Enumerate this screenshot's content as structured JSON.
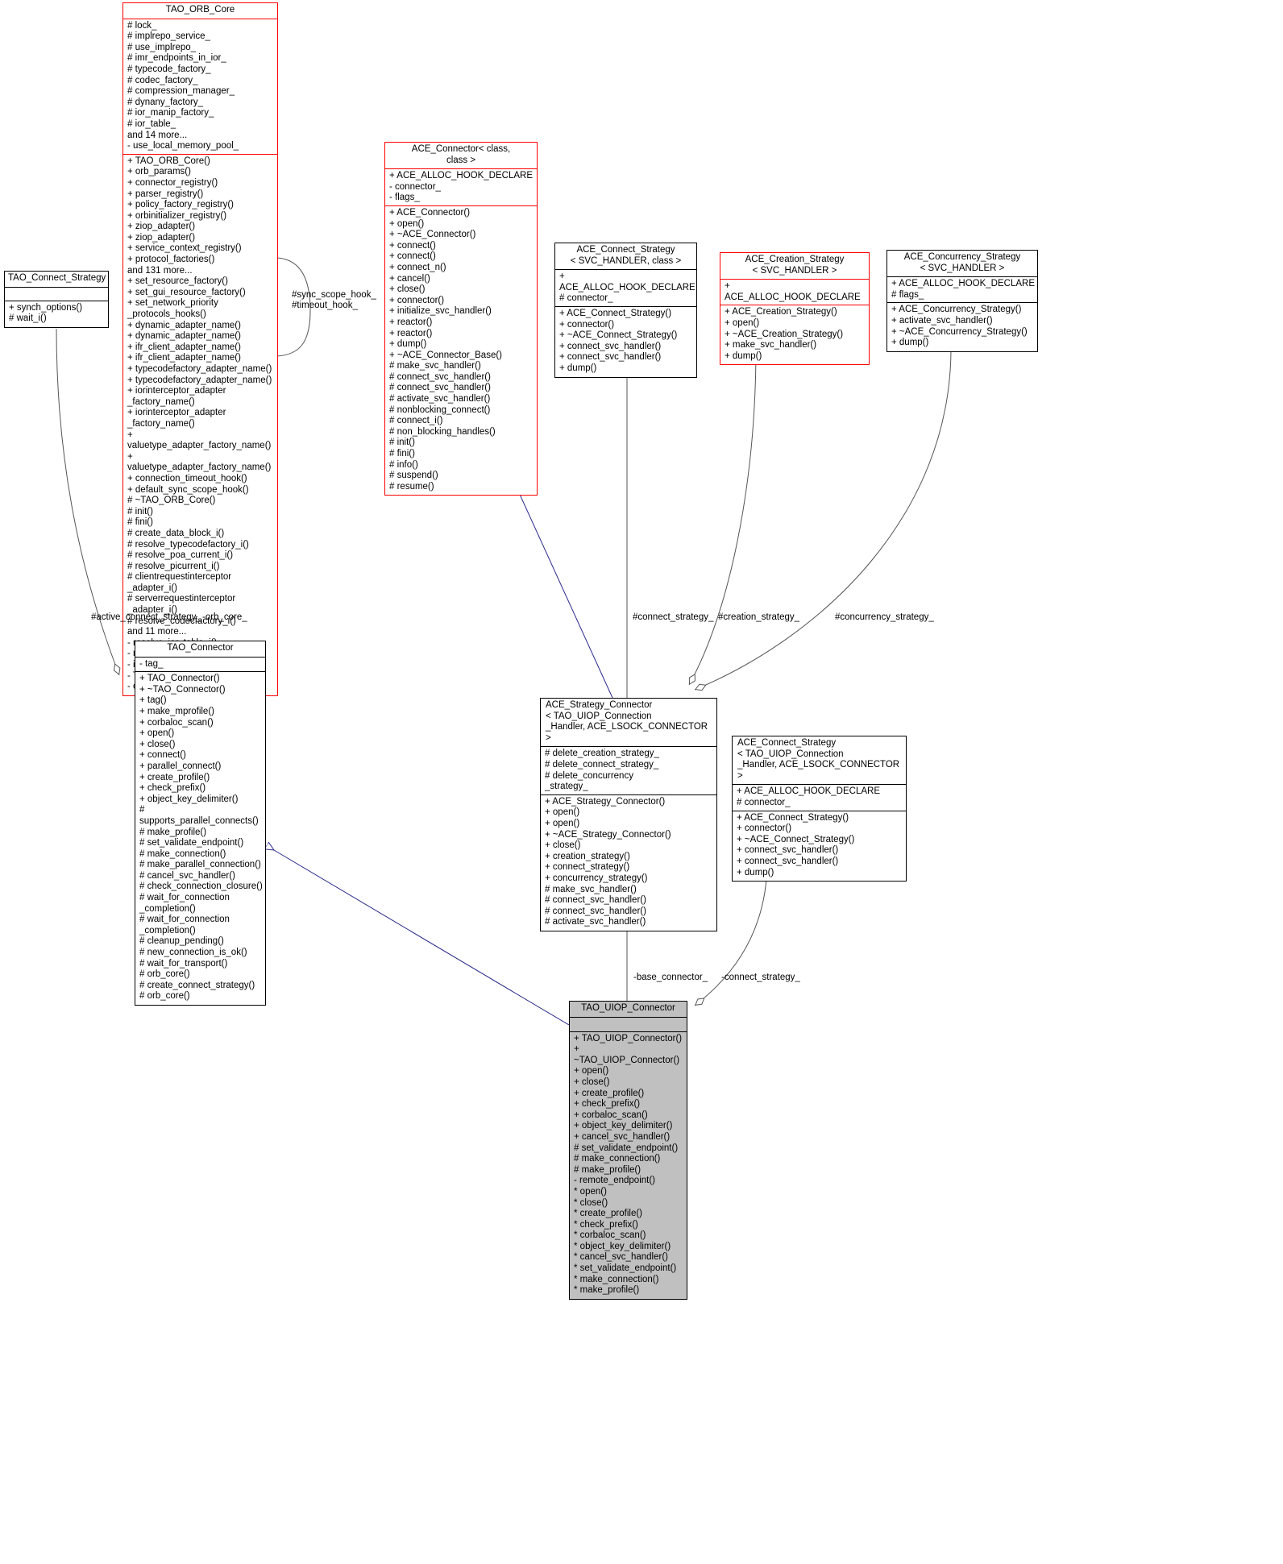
{
  "diagram": {
    "type": "uml-class-diagram",
    "colors": {
      "red_border": "#ff0000",
      "black_border": "#000000",
      "selected_fill": "#c0c0c0",
      "inheritance_arrow": "#2a2a8c",
      "background": "#ffffff"
    }
  },
  "classes": {
    "tao_orb_core": {
      "name": "TAO_ORB_Core",
      "attrs": [
        "# lock_",
        "# implrepo_service_",
        "# use_implrepo_",
        "# imr_endpoints_in_ior_",
        "# typecode_factory_",
        "# codec_factory_",
        "# compression_manager_",
        "# dynany_factory_",
        "# ior_manip_factory_",
        "# ior_table_",
        "and 14 more...",
        "- use_local_memory_pool_"
      ],
      "ops": [
        "+ TAO_ORB_Core()",
        "+ orb_params()",
        "+ connector_registry()",
        "+ parser_registry()",
        "+ policy_factory_registry()",
        "+ orbinitializer_registry()",
        "+ ziop_adapter()",
        "+ ziop_adapter()",
        "+ service_context_registry()",
        "+ protocol_factories()",
        "and 131 more...",
        "+ set_resource_factory()",
        "+ set_gui_resource_factory()",
        "+ set_network_priority\n_protocols_hooks()",
        "+ dynamic_adapter_name()",
        "+ dynamic_adapter_name()",
        "+ ifr_client_adapter_name()",
        "+ ifr_client_adapter_name()",
        "+ typecodefactory_adapter_name()",
        "+ typecodefactory_adapter_name()",
        "+ iorinterceptor_adapter\n_factory_name()",
        "+ iorinterceptor_adapter\n_factory_name()",
        "+ valuetype_adapter_factory_name()",
        "+ valuetype_adapter_factory_name()",
        "+ connection_timeout_hook()",
        "+ default_sync_scope_hook()",
        "# ~TAO_ORB_Core()",
        "# init()",
        "# fini()",
        "# create_data_block_i()",
        "# resolve_typecodefactory_i()",
        "# resolve_poa_current_i()",
        "# resolve_picurrent_i()",
        "# clientrequestinterceptor\n_adapter_i()",
        "# serverrequestinterceptor\n_adapter_i()",
        "# resolve_codecfactory_i()",
        "and 11 more...",
        "- resolve_ior_table_i()",
        "- resolve_async_ior_table_i()",
        "- is_collocation_enabled()",
        "- TAO_ORB_Core()",
        "- operator=()"
      ]
    },
    "tao_connect_strategy": {
      "name": "TAO_Connect_Strategy",
      "attrs": [],
      "ops": [
        "+ synch_options()",
        "# wait_i()"
      ]
    },
    "ace_connector": {
      "name": "ACE_Connector< class,\n            class >",
      "attrs": [
        "+ ACE_ALLOC_HOOK_DECLARE",
        "- connector_",
        "- flags_"
      ],
      "ops": [
        "+ ACE_Connector()",
        "+ open()",
        "+ ~ACE_Connector()",
        "+ connect()",
        "+ connect()",
        "+ connect_n()",
        "+ cancel()",
        "+ close()",
        "+ connector()",
        "+ initialize_svc_handler()",
        "+ reactor()",
        "+ reactor()",
        "+ dump()",
        "+ ~ACE_Connector_Base()",
        "# make_svc_handler()",
        "# connect_svc_handler()",
        "# connect_svc_handler()",
        "# activate_svc_handler()",
        "# nonblocking_connect()",
        "# connect_i()",
        "# non_blocking_handles()",
        "# init()",
        "# fini()",
        "# info()",
        "# suspend()",
        "# resume()"
      ]
    },
    "ace_connect_strategy_generic": {
      "name": "ACE_Connect_Strategy\n< SVC_HANDLER, class >",
      "attrs": [
        "+ ACE_ALLOC_HOOK_DECLARE",
        "# connector_"
      ],
      "ops": [
        "+ ACE_Connect_Strategy()",
        "+ connector()",
        "+ ~ACE_Connect_Strategy()",
        "+ connect_svc_handler()",
        "+ connect_svc_handler()",
        "+ dump()"
      ]
    },
    "ace_creation_strategy": {
      "name": "ACE_Creation_Strategy\n< SVC_HANDLER >",
      "attrs": [
        "+ ACE_ALLOC_HOOK_DECLARE"
      ],
      "ops": [
        "+ ACE_Creation_Strategy()",
        "+ open()",
        "+ ~ACE_Creation_Strategy()",
        "+ make_svc_handler()",
        "+ dump()"
      ]
    },
    "ace_concurrency_strategy": {
      "name": "ACE_Concurrency_Strategy\n< SVC_HANDLER >",
      "attrs": [
        "+ ACE_ALLOC_HOOK_DECLARE",
        "# flags_"
      ],
      "ops": [
        "+ ACE_Concurrency_Strategy()",
        "+ activate_svc_handler()",
        "+ ~ACE_Concurrency_Strategy()",
        "+ dump()"
      ]
    },
    "tao_connector": {
      "name": "TAO_Connector",
      "attrs": [
        "- tag_"
      ],
      "ops": [
        "+ TAO_Connector()",
        "+ ~TAO_Connector()",
        "+ tag()",
        "+ make_mprofile()",
        "+ corbaloc_scan()",
        "+ open()",
        "+ close()",
        "+ connect()",
        "+ parallel_connect()",
        "+ create_profile()",
        "+ check_prefix()",
        "+ object_key_delimiter()",
        "# supports_parallel_connects()",
        "# make_profile()",
        "# set_validate_endpoint()",
        "# make_connection()",
        "# make_parallel_connection()",
        "# cancel_svc_handler()",
        "# check_connection_closure()",
        "# wait_for_connection\n_completion()",
        "# wait_for_connection\n_completion()",
        "# cleanup_pending()",
        "# new_connection_is_ok()",
        "# wait_for_transport()",
        "# orb_core()",
        "# create_connect_strategy()",
        "# orb_core()"
      ]
    },
    "ace_strategy_connector": {
      "name": "ACE_Strategy_Connector\n< TAO_UIOP_Connection\n_Handler, ACE_LSOCK_CONNECTOR >",
      "attrs": [
        "# delete_creation_strategy_",
        "# delete_connect_strategy_",
        "# delete_concurrency\n_strategy_"
      ],
      "ops": [
        "+ ACE_Strategy_Connector()",
        "+ open()",
        "+ open()",
        "+ ~ACE_Strategy_Connector()",
        "+ close()",
        "+ creation_strategy()",
        "+ connect_strategy()",
        "+ concurrency_strategy()",
        "# make_svc_handler()",
        "# connect_svc_handler()",
        "# connect_svc_handler()",
        "# activate_svc_handler()"
      ]
    },
    "ace_connect_strategy_uiop": {
      "name": "ACE_Connect_Strategy\n< TAO_UIOP_Connection\n_Handler, ACE_LSOCK_CONNECTOR >",
      "attrs": [
        "+ ACE_ALLOC_HOOK_DECLARE",
        "# connector_"
      ],
      "ops": [
        "+ ACE_Connect_Strategy()",
        "+ connector()",
        "+ ~ACE_Connect_Strategy()",
        "+ connect_svc_handler()",
        "+ connect_svc_handler()",
        "+ dump()"
      ]
    },
    "tao_uiop_connector": {
      "name": "TAO_UIOP_Connector",
      "attrs": [],
      "ops": [
        "+ TAO_UIOP_Connector()",
        "+ ~TAO_UIOP_Connector()",
        "+ open()",
        "+ close()",
        "+ create_profile()",
        "+ check_prefix()",
        "+ corbaloc_scan()",
        "+ object_key_delimiter()",
        "+ cancel_svc_handler()",
        "# set_validate_endpoint()",
        "# make_connection()",
        "# make_profile()",
        "- remote_endpoint()",
        "* open()",
        "* close()",
        "* create_profile()",
        "* check_prefix()",
        "* corbaloc_scan()",
        "* object_key_delimiter()",
        "* cancel_svc_handler()",
        "* set_validate_endpoint()",
        "* make_connection()",
        "* make_profile()"
      ]
    }
  },
  "edge_labels": {
    "sync_scope_timeout": "#sync_scope_hook_\n#timeout_hook_",
    "active_connect_strategy": "#active_connect_strategy_",
    "orb_core": "-orb_core_",
    "connect_strategy": "#connect_strategy_",
    "creation_strategy": "#creation_strategy_",
    "concurrency_strategy": "#concurrency_strategy_",
    "base_connector": "-base_connector_",
    "connect_strategy_assoc": "-connect_strategy_"
  }
}
